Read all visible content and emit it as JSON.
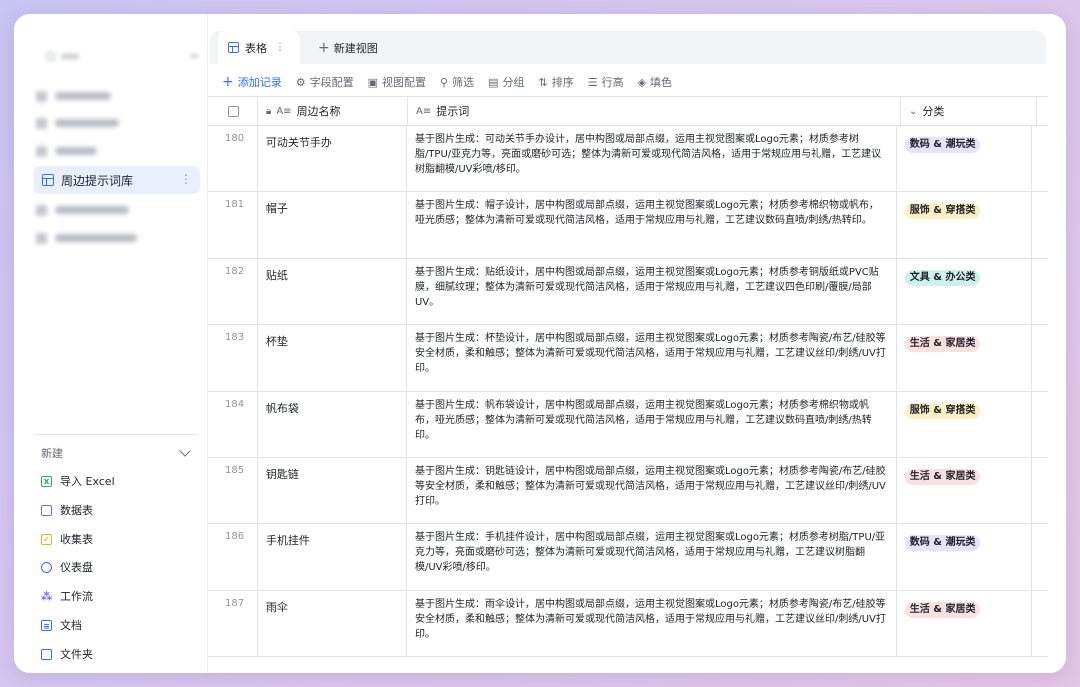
{
  "sidebar": {
    "active_item": "周边提示词库",
    "new_section": {
      "title": "新建",
      "items": [
        {
          "label": "导入 Excel",
          "icon": "excel-icon",
          "color": "#34a853"
        },
        {
          "label": "数据表",
          "icon": "datasheet-icon",
          "color": "#7b61ff"
        },
        {
          "label": "收集表",
          "icon": "form-icon",
          "color": "#f5a623"
        },
        {
          "label": "仪表盘",
          "icon": "dashboard-icon",
          "color": "#3370ff"
        },
        {
          "label": "工作流",
          "icon": "workflow-icon",
          "color": "#7b61ff"
        },
        {
          "label": "文档",
          "icon": "doc-icon",
          "color": "#3370ff"
        },
        {
          "label": "文件夹",
          "icon": "folder-icon",
          "color": "#3370ff"
        }
      ]
    }
  },
  "tabs": {
    "active": "表格",
    "new_view": "新建视图"
  },
  "toolbar": {
    "add_record": "添加记录",
    "field_config": "字段配置",
    "view_config": "视图配置",
    "filter": "筛选",
    "group": "分组",
    "sort": "排序",
    "row_height": "行高",
    "fill_color": "填色"
  },
  "table": {
    "columns": {
      "name": "周边名称",
      "prompt": "提示词",
      "category": "分类"
    },
    "rows": [
      {
        "index": "180",
        "name": "可动关节手办",
        "prompt": "基于图片生成：可动关节手办设计，居中构图或局部点缀，运用主视觉图案或Logo元素；材质参考树脂/TPU/亚克力等，亮面或磨砂可选；整体为清新可爱或现代简洁风格，适用于常规应用与礼赠，工艺建议树脂翻模/UV彩喷/移印。",
        "category": "数码 & 潮玩类",
        "cat_bg": "#e6e2fa"
      },
      {
        "index": "181",
        "name": "帽子",
        "prompt": "基于图片生成：帽子设计，居中构图或局部点缀，运用主视觉图案或Logo元素；材质参考棉织物或帆布，哑光质感；整体为清新可爱或现代简洁风格，适用于常规应用与礼赠，工艺建议数码直喷/刺绣/热转印。",
        "category": "服饰 & 穿搭类",
        "cat_bg": "#fbefc4"
      },
      {
        "index": "182",
        "name": "贴纸",
        "prompt": "基于图片生成：贴纸设计，居中构图或局部点缀，运用主视觉图案或Logo元素；材质参考铜版纸或PVC贴膜，细腻纹理；整体为清新可爱或现代简洁风格，适用于常规应用与礼赠，工艺建议四色印刷/覆膜/局部UV。",
        "category": "文具 & 办公类",
        "cat_bg": "#cdf1ea"
      },
      {
        "index": "183",
        "name": "杯垫",
        "prompt": "基于图片生成：杯垫设计，居中构图或局部点缀，运用主视觉图案或Logo元素；材质参考陶瓷/布艺/硅胶等安全材质，柔和触感；整体为清新可爱或现代简洁风格，适用于常规应用与礼赠，工艺建议丝印/刺绣/UV打印。",
        "category": "生活 & 家居类",
        "cat_bg": "#fbe0e0"
      },
      {
        "index": "184",
        "name": "帆布袋",
        "prompt": "基于图片生成：帆布袋设计，居中构图或局部点缀，运用主视觉图案或Logo元素；材质参考棉织物或帆布，哑光质感；整体为清新可爱或现代简洁风格，适用于常规应用与礼赠，工艺建议数码直喷/刺绣/热转印。",
        "category": "服饰 & 穿搭类",
        "cat_bg": "#fbefc4"
      },
      {
        "index": "185",
        "name": "钥匙链",
        "prompt": "基于图片生成：钥匙链设计，居中构图或局部点缀，运用主视觉图案或Logo元素；材质参考陶瓷/布艺/硅胶等安全材质，柔和触感；整体为清新可爱或现代简洁风格，适用于常规应用与礼赠，工艺建议丝印/刺绣/UV打印。",
        "category": "生活 & 家居类",
        "cat_bg": "#fbe0e0"
      },
      {
        "index": "186",
        "name": "手机挂件",
        "prompt": "基于图片生成：手机挂件设计，居中构图或局部点缀，运用主视觉图案或Logo元素；材质参考树脂/TPU/亚克力等，亮面或磨砂可选；整体为清新可爱或现代简洁风格，适用于常规应用与礼赠，工艺建议树脂翻模/UV彩喷/移印。",
        "category": "数码 & 潮玩类",
        "cat_bg": "#e6e2fa"
      },
      {
        "index": "187",
        "name": "雨伞",
        "prompt": "基于图片生成：雨伞设计，居中构图或局部点缀，运用主视觉图案或Logo元素；材质参考陶瓷/布艺/硅胶等安全材质，柔和触感；整体为清新可爱或现代简洁风格，适用于常规应用与礼赠，工艺建议丝印/刺绣/UV打印。",
        "category": "生活 & 家居类",
        "cat_bg": "#fbe0e0"
      }
    ]
  },
  "colors": {
    "accent": "#3370ff",
    "active_bg": "#eaeffc"
  }
}
